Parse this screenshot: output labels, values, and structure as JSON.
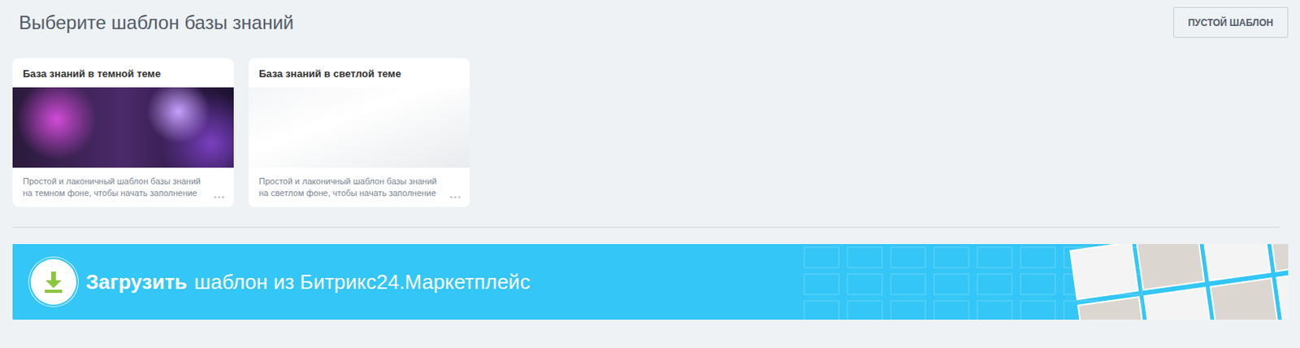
{
  "header": {
    "title": "Выберите шаблон базы знаний",
    "emptyButton": "ПУСТОЙ ШАБЛОН"
  },
  "templates": [
    {
      "title": "База знаний в темной теме",
      "description": "Простой и лаконичный шаблон базы знаний на темном фоне, чтобы начать заполнение",
      "theme": "dark"
    },
    {
      "title": "База знаний в светлой теме",
      "description": "Простой и лаконичный шаблон базы знаний на светлом фоне, чтобы начать заполнение",
      "theme": "light"
    }
  ],
  "banner": {
    "action": "Загрузить",
    "text": "шаблон из Битрикс24.Маркетплейс"
  }
}
